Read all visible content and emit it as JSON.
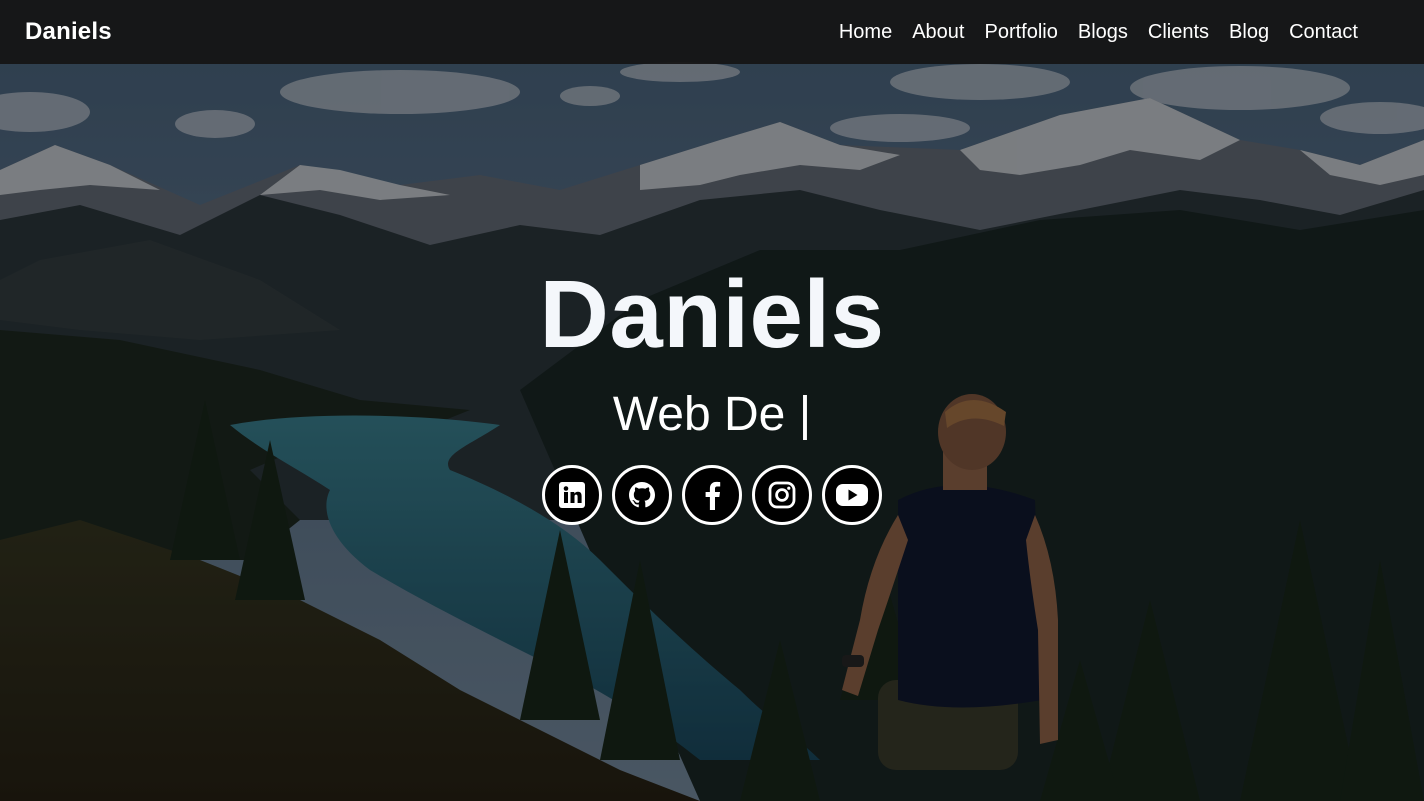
{
  "navbar": {
    "brand": "Daniels",
    "links": [
      {
        "label": "Home"
      },
      {
        "label": "About"
      },
      {
        "label": "Portfolio"
      },
      {
        "label": "Blogs"
      },
      {
        "label": "Clients"
      },
      {
        "label": "Blog"
      },
      {
        "label": "Contact"
      }
    ]
  },
  "hero": {
    "title": "Daniels",
    "subtitle": "Web De |",
    "social": [
      {
        "icon": "linkedin-icon"
      },
      {
        "icon": "github-icon"
      },
      {
        "icon": "facebook-icon"
      },
      {
        "icon": "instagram-icon"
      },
      {
        "icon": "youtube-icon"
      }
    ]
  },
  "colors": {
    "navbar_bg": "#141414",
    "text": "#ffffff",
    "social_bg": "#000000"
  }
}
